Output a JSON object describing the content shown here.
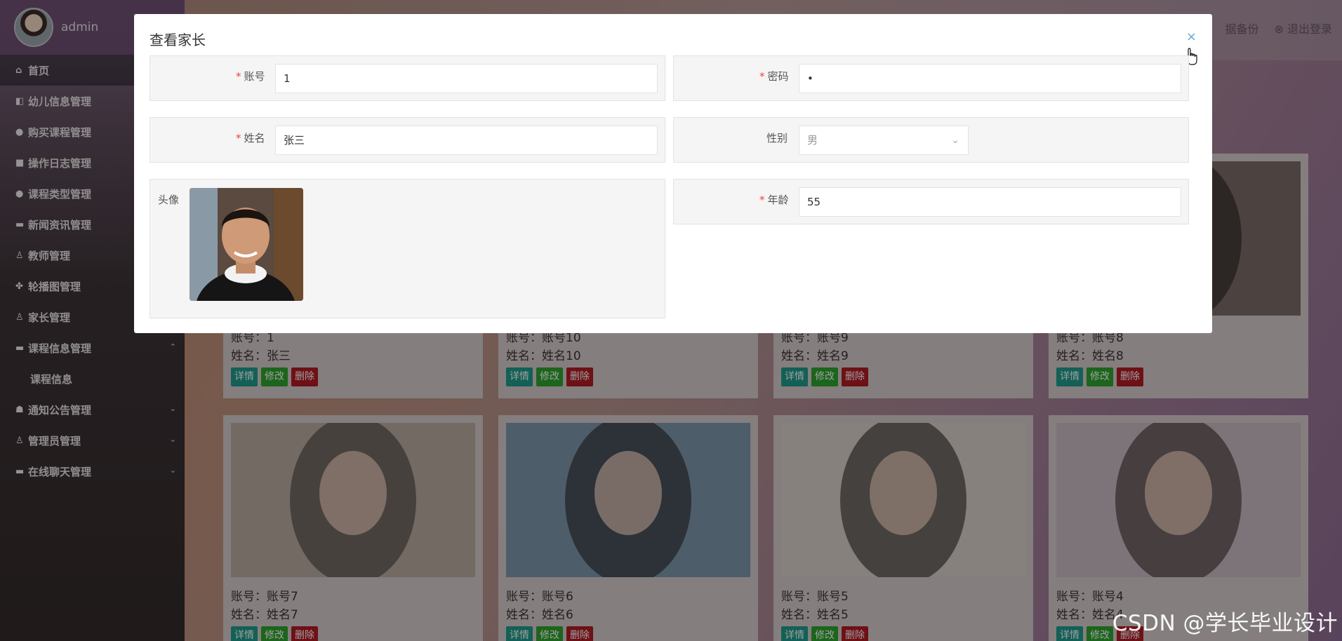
{
  "app": {
    "user": "admin",
    "menu": [
      {
        "label": "首页",
        "icon": "home-icon",
        "glyph": "⌂"
      },
      {
        "label": "幼儿信息管理",
        "icon": "book-icon",
        "glyph": "◧"
      },
      {
        "label": "购买课程管理",
        "icon": "circle-icon",
        "glyph": "●"
      },
      {
        "label": "操作日志管理",
        "icon": "log-icon",
        "glyph": "■"
      },
      {
        "label": "课程类型管理",
        "icon": "circle-icon",
        "glyph": "●"
      },
      {
        "label": "新闻资讯管理",
        "icon": "news-icon",
        "glyph": "▬"
      },
      {
        "label": "教师管理",
        "icon": "user-icon",
        "glyph": "♙"
      },
      {
        "label": "轮播图管理",
        "icon": "carousel-icon",
        "glyph": "✤"
      },
      {
        "label": "家长管理",
        "icon": "parent-icon",
        "glyph": "♙"
      },
      {
        "label": "课程信息管理",
        "icon": "course-icon",
        "glyph": "▬",
        "chevron": "⌃"
      },
      {
        "label": "课程信息",
        "sub": true
      },
      {
        "label": "通知公告管理",
        "icon": "notice-icon",
        "glyph": "☗",
        "chevron": "⌄"
      },
      {
        "label": "管理员管理",
        "icon": "admin-icon",
        "glyph": "♙",
        "chevron": "⌄"
      },
      {
        "label": "在线聊天管理",
        "icon": "chat-icon",
        "glyph": "▬",
        "chevron": "⌄"
      }
    ],
    "top_actions": [
      {
        "label": "据备份",
        "icon": "backup-icon",
        "glyph": ""
      },
      {
        "label": "退出登录",
        "icon": "logout-icon",
        "glyph": "⊗"
      }
    ]
  },
  "cards": [
    {
      "account": "账号：1",
      "name": "姓名：张三"
    },
    {
      "account": "账号：账号10",
      "name": "姓名：姓名10"
    },
    {
      "account": "账号：账号9",
      "name": "姓名：姓名9"
    },
    {
      "account": "账号：账号8",
      "name": "姓名：姓名8"
    },
    {
      "account": "账号：账号7",
      "name": "姓名：姓名7"
    },
    {
      "account": "账号：账号6",
      "name": "姓名：姓名6"
    },
    {
      "account": "账号：账号5",
      "name": "姓名：姓名5"
    },
    {
      "account": "账号：账号4",
      "name": "姓名：姓名4"
    }
  ],
  "card_buttons": {
    "detail": "详情",
    "edit": "修改",
    "delete": "删除"
  },
  "modal": {
    "title": "查看家长",
    "close": "×",
    "fields": {
      "account": {
        "label": "账号",
        "required": "*",
        "value": "1"
      },
      "password": {
        "label": "密码",
        "required": "*",
        "value": "•"
      },
      "name": {
        "label": "姓名",
        "required": "*",
        "value": "张三"
      },
      "gender": {
        "label": "性别",
        "value": "男",
        "arrow": "⌄"
      },
      "avatar": {
        "label": "头像"
      },
      "age": {
        "label": "年龄",
        "required": "*",
        "value": "55"
      }
    }
  },
  "watermark": "CSDN @学长毕业设计"
}
